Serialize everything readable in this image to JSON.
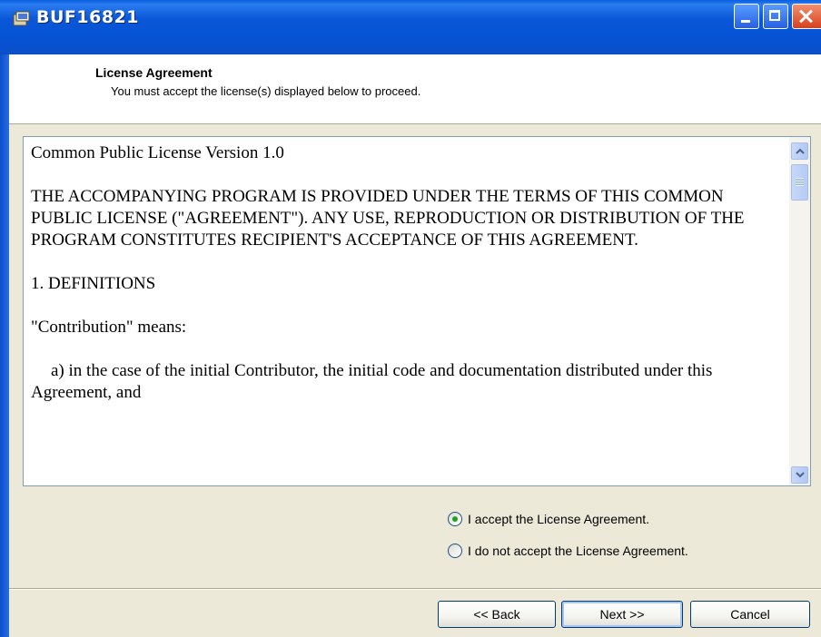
{
  "window": {
    "title": "BUF16821",
    "app_icon": "installer-icon"
  },
  "header": {
    "title": "License Agreement",
    "subtitle": "You must accept the license(s) displayed below to proceed."
  },
  "license": {
    "paragraphs": [
      "Common Public License Version 1.0",
      "THE ACCOMPANYING PROGRAM IS PROVIDED UNDER THE TERMS OF THIS COMMON PUBLIC LICENSE (\"AGREEMENT\"). ANY USE, REPRODUCTION OR DISTRIBUTION OF THE PROGRAM CONSTITUTES RECIPIENT'S ACCEPTANCE OF THIS AGREEMENT.",
      "1. DEFINITIONS",
      "\"Contribution\" means:",
      "a) in the case of the initial Contributor, the initial code and documentation distributed under this Agreement, and"
    ]
  },
  "options": {
    "accept_label": "I accept the License Agreement.",
    "decline_label": "I do not accept the License Agreement.",
    "selected": "accept"
  },
  "buttons": {
    "back": "<< Back",
    "next": "Next >>",
    "cancel": "Cancel"
  },
  "colors": {
    "title_bar": "#0553d4",
    "dialog_background": "#ece9d8",
    "radio_selected": "#21a121"
  }
}
